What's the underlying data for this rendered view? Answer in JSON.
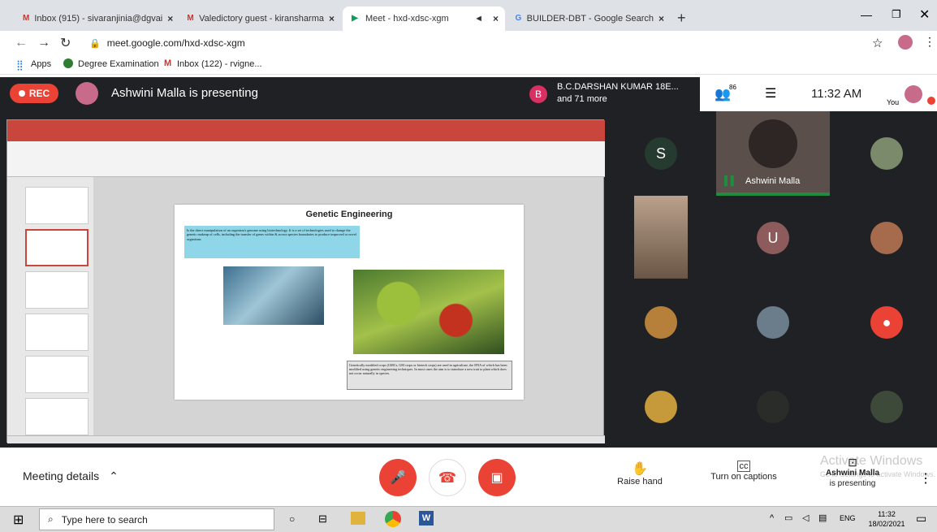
{
  "tabs": [
    {
      "icon": "M",
      "label": "Inbox (915) - sivaranjinia@dgvai"
    },
    {
      "icon": "M",
      "label": "Valedictory guest - kiransharma"
    },
    {
      "icon": "▶",
      "label": "Meet - hxd-xdsc-xgm"
    },
    {
      "icon": "G",
      "label": "BUILDER-DBT - Google Search"
    }
  ],
  "url": "meet.google.com/hxd-xdsc-xgm",
  "bookmarks": [
    "Apps",
    "Degree Examination",
    "Inbox (122) - rvigne..."
  ],
  "meet": {
    "rec_label": "REC",
    "presenter_text": "Ashwini Malla is presenting",
    "participant_name": "B.C.DARSHAN KUMAR 18E...",
    "participant_more": "and 71 more",
    "participant_initial": "B",
    "people_count": "86",
    "time": "11:32 AM",
    "you_label": "You",
    "tile_name": "Ashwini Malla",
    "tile_initials": [
      "S",
      "U"
    ]
  },
  "slide": {
    "title": "Genetic Engineering",
    "definition": "Is the direct manipulation of an organism's genome using biotechnology. It is a set of technologies used to change the genetic makeup of cells, including the transfer of genes within & across species boundaries to produce improved or novel organisms",
    "caption": "Genetically modified crops (GMCs, GM crops or biotech crops) are used in agriculture, the DNA of which has been modified using genetic engineering techniques. In most cases the aim is to introduce a new trait to plant which does not occur naturally in species."
  },
  "bottom": {
    "meeting_details": "Meeting details",
    "raise_hand": "Raise hand",
    "captions": "Turn on captions",
    "presenting_line1": "Ashwini Malla",
    "presenting_line2": "is presenting",
    "watermark": "Activate Windows",
    "watermark_sub": "Go to Settings to activate Windows."
  },
  "taskbar": {
    "search_placeholder": "Type here to search",
    "lang": "ENG",
    "time": "11:32",
    "date": "18/02/2021"
  },
  "colors": {
    "red": "#ea4335",
    "meet_bg": "#202124",
    "teal": "#1e8e3e"
  }
}
